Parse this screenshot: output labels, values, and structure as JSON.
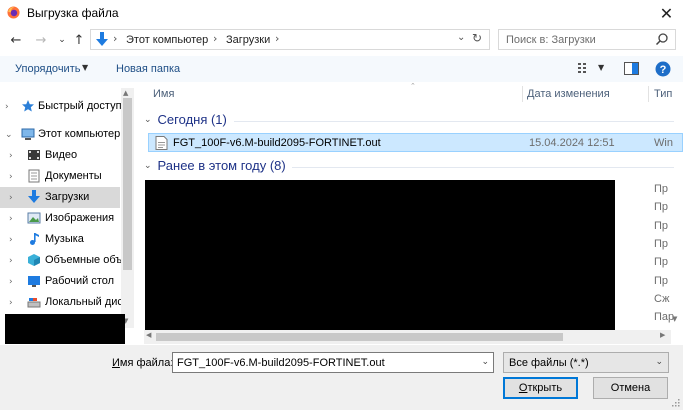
{
  "window": {
    "title": "Выгрузка файла",
    "close_glyph": "✕"
  },
  "nav": {
    "back_glyph": "←",
    "forward_glyph": "→",
    "recent_glyph": "⌄",
    "up_glyph": "↑",
    "breadcrumbs": [
      "Этот компьютер",
      "Загрузки"
    ],
    "crumb_sep": "›",
    "dropdown_glyph": "⌄",
    "refresh_glyph": "↻",
    "search_placeholder": "Поиск в: Загрузки"
  },
  "toolbar": {
    "organize_label": "Упорядочить",
    "new_folder_label": "Новая папка",
    "caret": "▼"
  },
  "sidebar": {
    "items": [
      {
        "label": "Быстрый доступ",
        "icon": "star-icon"
      },
      {
        "label": "Этот компьютер",
        "icon": "computer-icon"
      },
      {
        "label": "Видео",
        "icon": "video-folder-icon"
      },
      {
        "label": "Документы",
        "icon": "documents-folder-icon"
      },
      {
        "label": "Загрузки",
        "icon": "downloads-folder-icon",
        "selected": true
      },
      {
        "label": "Изображения",
        "icon": "pictures-folder-icon"
      },
      {
        "label": "Музыка",
        "icon": "music-folder-icon"
      },
      {
        "label": "Объемные объ",
        "icon": "3d-objects-icon"
      },
      {
        "label": "Рабочий стол",
        "icon": "desktop-folder-icon"
      },
      {
        "label": "Локальный дис",
        "icon": "local-disk-icon"
      }
    ],
    "chev_right": "›",
    "chev_down": "⌄"
  },
  "columns": {
    "name": "Имя",
    "date": "Дата изменения",
    "type": "Тип"
  },
  "groups": {
    "today": "Сегодня (1)",
    "earlier": "Ранее в этом году (8)",
    "chev": "⌄"
  },
  "files": {
    "selected": {
      "name": "FGT_100F-v6.M-build2095-FORTINET.out",
      "date": "15.04.2024 12:51",
      "type": "Win"
    },
    "earlier_types": [
      "Пр",
      "Пр",
      "Пр",
      "Пр",
      "Пр",
      "Пр",
      "Сж",
      "Пар"
    ]
  },
  "bottom": {
    "filename_label_u": "И",
    "filename_label_rest": "мя файла:",
    "filename_value": "FGT_100F-v6.M-build2095-FORTINET.out",
    "filter_value": "Все файлы (*.*)",
    "open_label_u": "О",
    "open_label_rest": "ткрыть",
    "cancel_label": "Отмена",
    "dd": "⌄"
  },
  "colors": {
    "accent": "#0078d7",
    "selection": "#cce8ff",
    "group_text": "#1e3287"
  }
}
